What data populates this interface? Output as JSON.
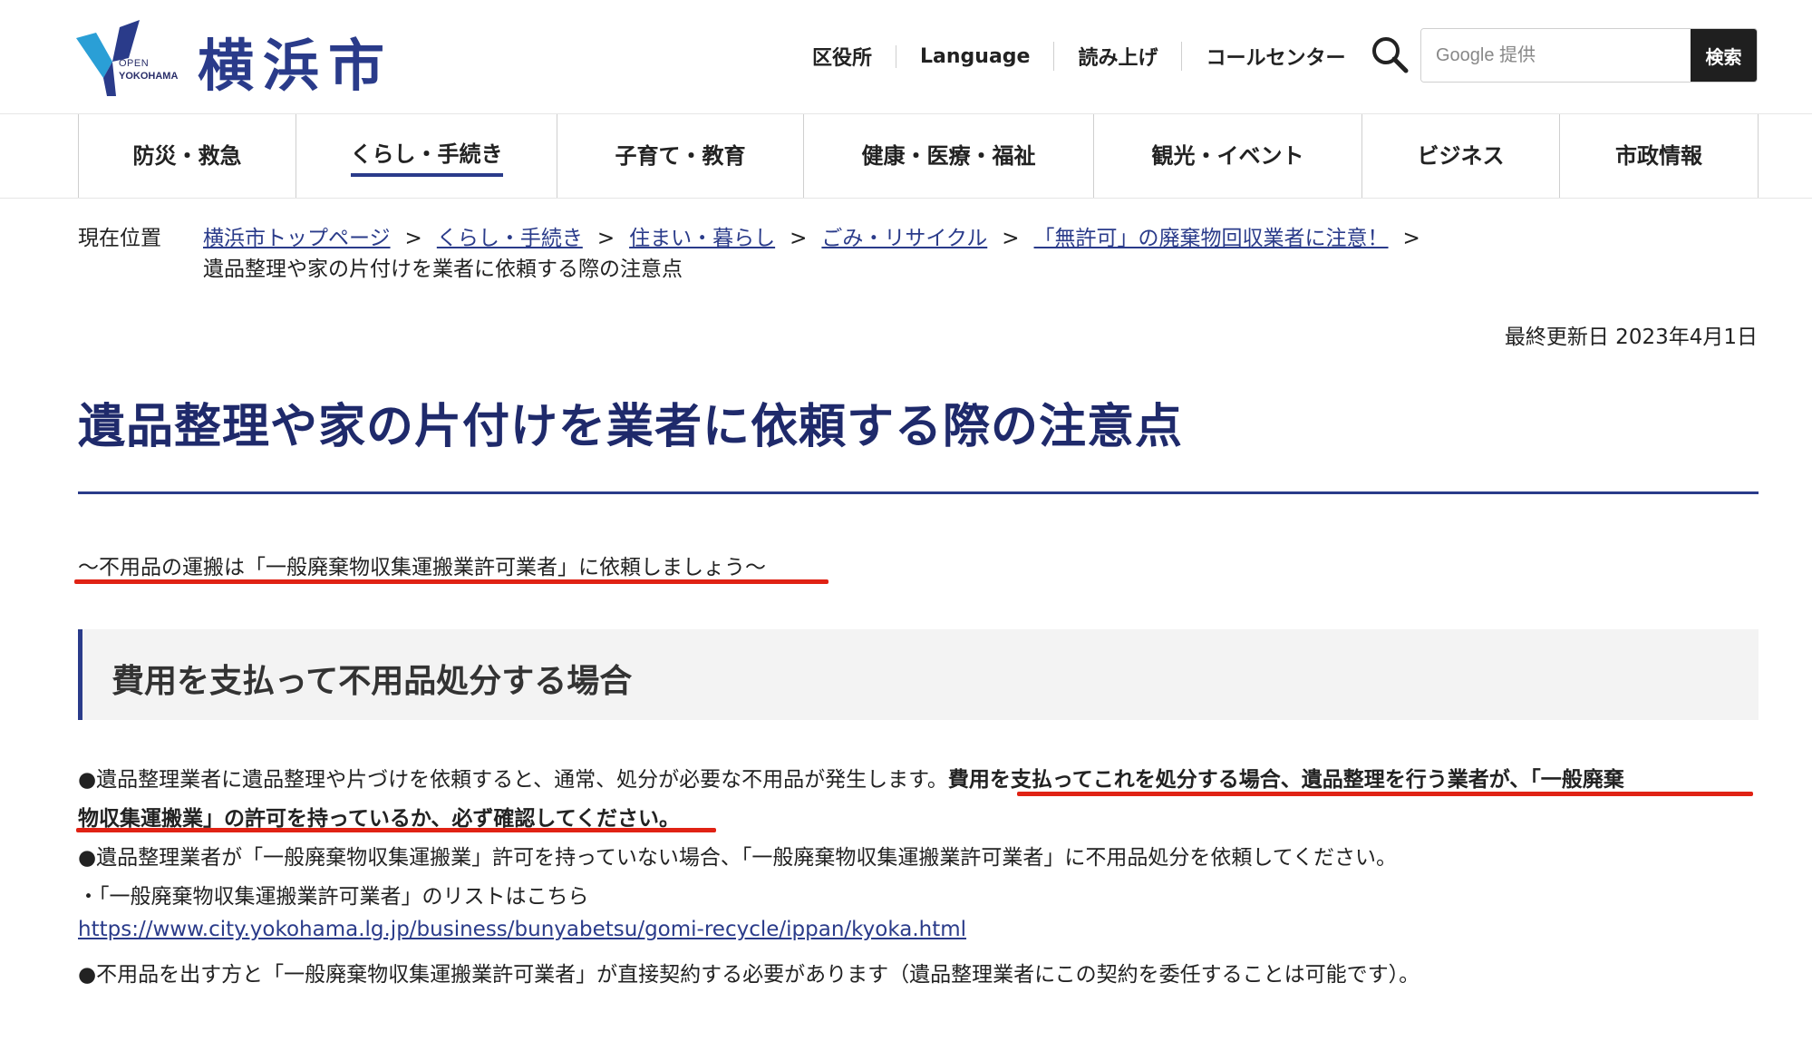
{
  "header": {
    "site_name": "横浜市",
    "logo_open": "OPEN",
    "logo_yokohama": "YOKOHAMA",
    "util_nav": [
      "区役所",
      "Language",
      "読み上げ",
      "コールセンター"
    ],
    "search_placeholder": "Google 提供",
    "search_button": "検索"
  },
  "gnav": {
    "items": [
      {
        "label": "防災・救急",
        "active": false
      },
      {
        "label": "くらし・手続き",
        "active": true
      },
      {
        "label": "子育て・教育",
        "active": false
      },
      {
        "label": "健康・医療・福祉",
        "active": false
      },
      {
        "label": "観光・イベント",
        "active": false
      },
      {
        "label": "ビジネス",
        "active": false
      },
      {
        "label": "市政情報",
        "active": false
      }
    ]
  },
  "breadcrumb": {
    "label": "現在位置",
    "links": [
      "横浜市トップページ",
      "くらし・手続き",
      "住まい・暮らし",
      "ごみ・リサイクル",
      "「無許可」の廃棄物回収業者に注意！"
    ],
    "separator": ">",
    "current": "遺品整理や家の片付けを業者に依頼する際の注意点"
  },
  "updated": "最終更新日 2023年4月1日",
  "page_title": "遺品整理や家の片付けを業者に依頼する際の注意点",
  "lead": "～不用品の運搬は「一般廃棄物収集運搬業許可業者」に依頼しましょう～",
  "section": {
    "title": "費用を支払って不用品処分する場合",
    "para1_normal": "●遺品整理業者に遺品整理や片づけを依頼すると、通常、処分が必要な不用品が発生します。",
    "para1_bold_a": "費用を支払ってこれを処分する場合、遺品整理を行う業者が、「一般廃棄",
    "para1_bold_b": "物収集運搬業」の許可を持っているか、必ず確認してください。",
    "para2": "●遺品整理業者が「一般廃棄物収集運搬業」許可を持っていない場合、「一般廃棄物収集運搬業許可業者」に不用品処分を依頼してください。",
    "para3": "・「一般廃棄物収集運搬業許可業者」のリストはこちら",
    "link_url": "https://www.city.yokohama.lg.jp/business/bunyabetsu/gomi-recycle/ippan/kyoka.html",
    "para4": "●不用品を出す方と「一般廃棄物収集運搬業許可業者」が直接契約する必要があります（遺品整理業者にこの契約を委任することは可能です）。"
  },
  "colors": {
    "brand": "#2a3b8a",
    "title": "#1f2a6b",
    "highlight": "#e02214"
  }
}
